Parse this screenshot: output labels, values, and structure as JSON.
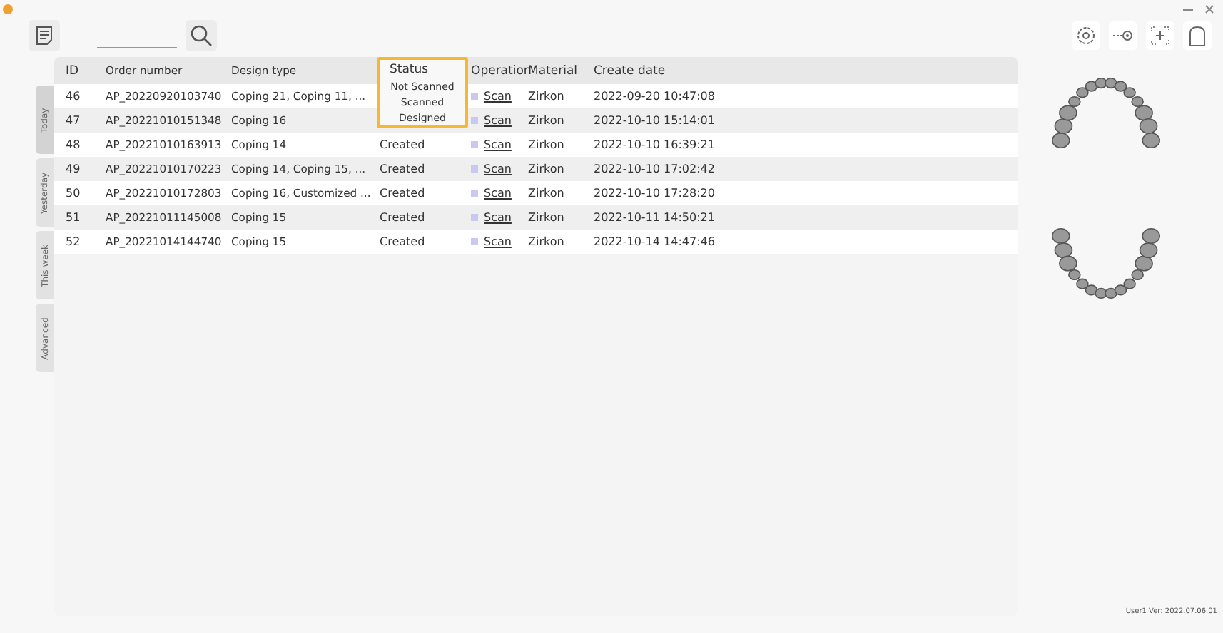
{
  "side_tabs": [
    {
      "label": "Today",
      "selected": true
    },
    {
      "label": "Yesterday",
      "selected": false
    },
    {
      "label": "This week",
      "selected": false
    },
    {
      "label": "Advanced",
      "selected": false
    }
  ],
  "table": {
    "columns": [
      "ID",
      "Order number",
      "Design type",
      "Status",
      "Operation",
      "Material",
      "Create date"
    ],
    "rows": [
      {
        "id": "46",
        "order": "AP_20220920103740",
        "design": "Coping 21, Coping 11, ...",
        "operation": "Scan",
        "material": "Zirkon",
        "date": "2022-09-20 10:47:08"
      },
      {
        "id": "47",
        "order": "AP_20221010151348",
        "design": "Coping 16",
        "operation": "Scan",
        "material": "Zirkon",
        "date": "2022-10-10 15:14:01"
      },
      {
        "id": "48",
        "order": "AP_20221010163913",
        "design": "Coping 14",
        "status": "Created",
        "operation": "Scan",
        "material": "Zirkon",
        "date": "2022-10-10 16:39:21"
      },
      {
        "id": "49",
        "order": "AP_20221010170223",
        "design": "Coping 14, Coping 15, ...",
        "status": "Created",
        "operation": "Scan",
        "material": "Zirkon",
        "date": "2022-10-10 17:02:42"
      },
      {
        "id": "50",
        "order": "AP_20221010172803",
        "design": "Coping 16, Customized ...",
        "status": "Created",
        "operation": "Scan",
        "material": "Zirkon",
        "date": "2022-10-10 17:28:20"
      },
      {
        "id": "51",
        "order": "AP_20221011145008",
        "design": "Coping 15",
        "status": "Created",
        "operation": "Scan",
        "material": "Zirkon",
        "date": "2022-10-11 14:50:21"
      },
      {
        "id": "52",
        "order": "AP_20221014144740",
        "design": "Coping 15",
        "status": "Created",
        "operation": "Scan",
        "material": "Zirkon",
        "date": "2022-10-14 14:47:46"
      }
    ]
  },
  "status_menu": {
    "options": [
      "Not Scanned",
      "Scanned",
      "Designed"
    ]
  },
  "footer": "User1  Ver: 2022.07.06.01"
}
